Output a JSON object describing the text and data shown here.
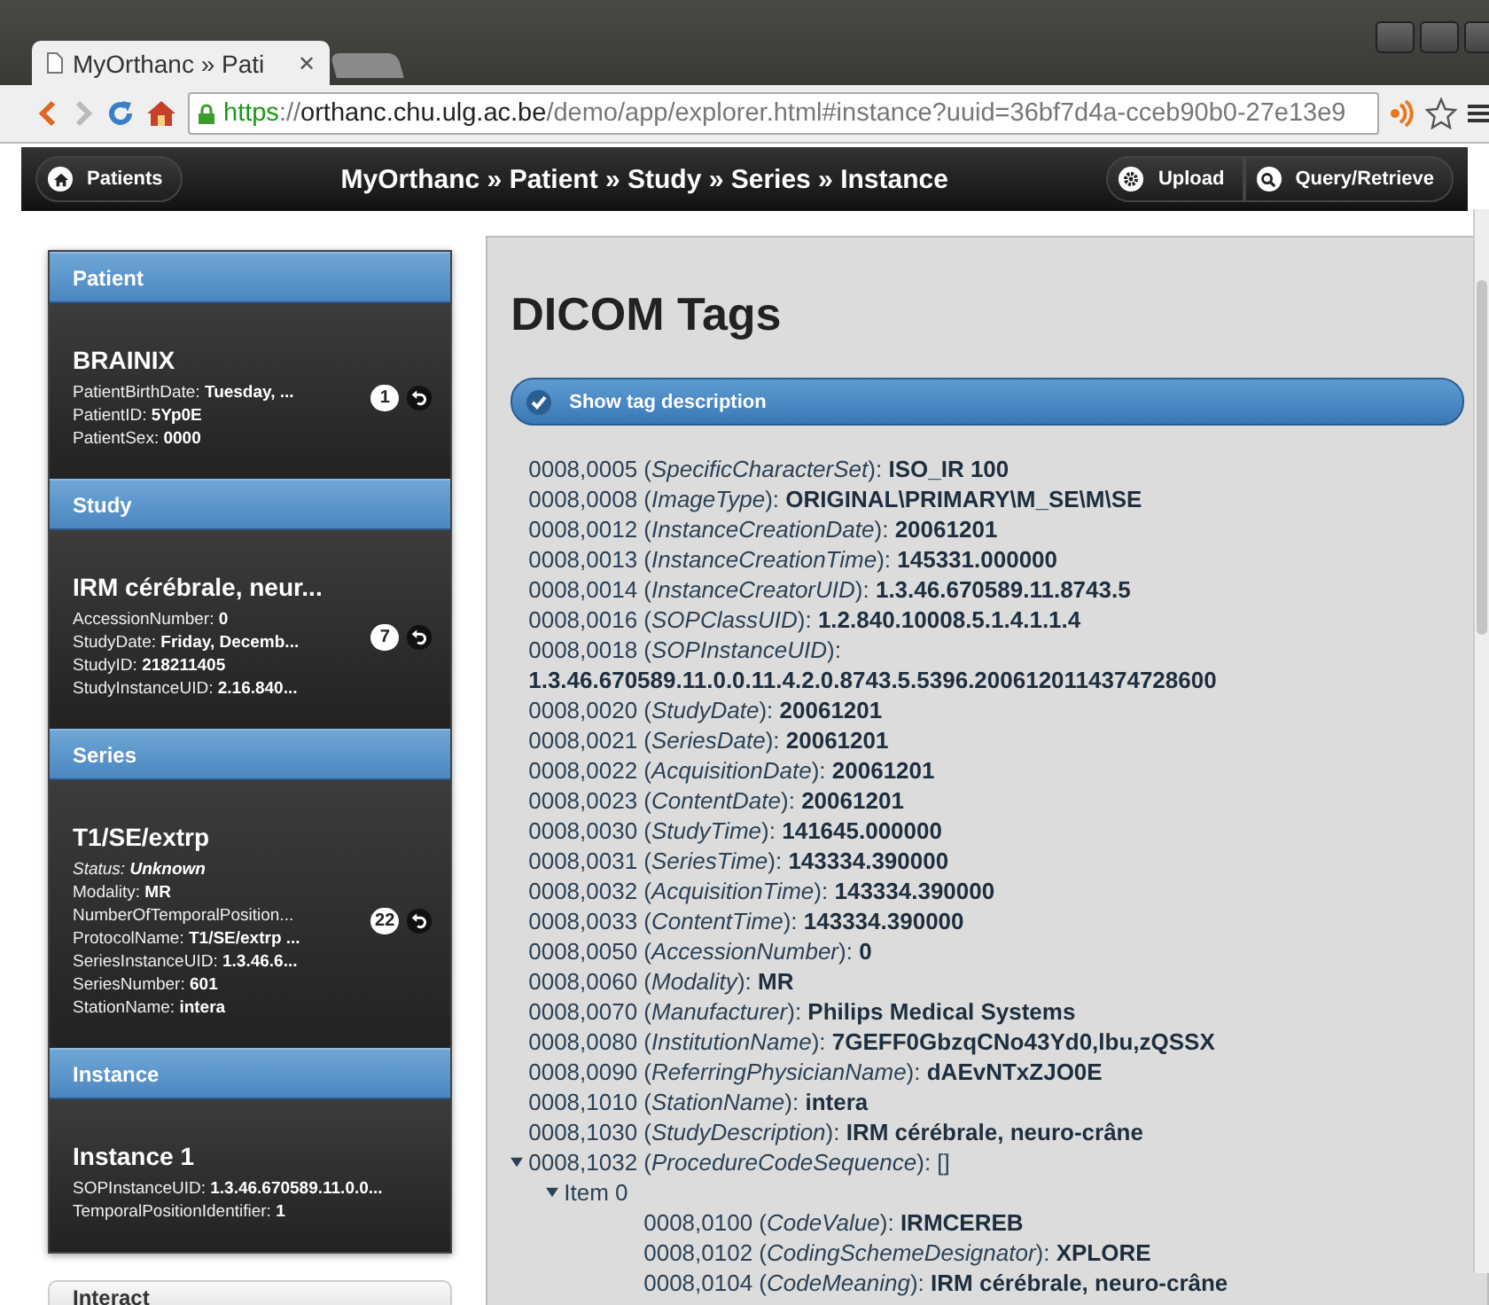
{
  "browser": {
    "tabs": [
      {
        "kind": "page",
        "title": "MyOrthanc » Pati",
        "close": "✕",
        "selected": true
      },
      {
        "kind": "new",
        "selected": false
      }
    ],
    "url": {
      "scheme": "https",
      "separator": "://",
      "host": "orthanc.chu.ulg.ac.be",
      "path": "/demo/app/explorer.html#instance?uuid=36bf7d4a-cceb90b0-27e13e9"
    }
  },
  "navbar": {
    "left_button": "Patients",
    "title": "MyOrthanc » Patient » Study » Series » Instance",
    "right_buttons": [
      "Upload",
      "Query/Retrieve"
    ]
  },
  "sidebar": [
    {
      "header": "Patient",
      "title": "BRAINIX",
      "count": "1",
      "fields": [
        {
          "label": "PatientBirthDate: ",
          "value": "Tuesday, ...",
          "italic": false
        },
        {
          "label": "PatientID: ",
          "value": "5Yp0E",
          "italic": false
        },
        {
          "label": "PatientSex: ",
          "value": "0000",
          "italic": false
        }
      ]
    },
    {
      "header": "Study",
      "title": "IRM cérébrale, neur...",
      "count": "7",
      "fields": [
        {
          "label": "AccessionNumber: ",
          "value": "0",
          "italic": false
        },
        {
          "label": "StudyDate: ",
          "value": "Friday, Decemb...",
          "italic": false
        },
        {
          "label": "StudyID: ",
          "value": "218211405",
          "italic": false
        },
        {
          "label": "StudyInstanceUID: ",
          "value": "2.16.840...",
          "italic": false
        }
      ]
    },
    {
      "header": "Series",
      "title": "T1/SE/extrp",
      "count": "22",
      "fields": [
        {
          "label": "Status: ",
          "value": "Unknown",
          "italic": true
        },
        {
          "label": "Modality: ",
          "value": "MR",
          "italic": false
        },
        {
          "label": "NumberOfTemporalPosition...",
          "italic": false
        },
        {
          "label": "ProtocolName: ",
          "value": "T1/SE/extrp ...",
          "italic": false
        },
        {
          "label": "SeriesInstanceUID: ",
          "value": "1.3.46.6...",
          "italic": false
        },
        {
          "label": "SeriesNumber: ",
          "value": "601",
          "italic": false
        },
        {
          "label": "StationName: ",
          "value": "intera",
          "italic": false
        }
      ]
    },
    {
      "header": "Instance",
      "title": "Instance 1",
      "fields": [
        {
          "label": "SOPInstanceUID: ",
          "value": "1.3.46.670589.11.0.0...",
          "italic": false
        },
        {
          "label": "TemporalPositionIdentifier: ",
          "value": "1",
          "italic": false
        }
      ]
    }
  ],
  "interact": {
    "header": "Interact"
  },
  "content": {
    "title": "DICOM Tags",
    "toggle": {
      "label": "Show tag description",
      "checked": true
    },
    "tags": [
      {
        "line": "0008,0005 (*SpecificCharacterSet*): **ISO_IR 100**"
      },
      {
        "line": "0008,0008 (*ImageType*): **ORIGINAL\\PRIMARY\\M_SE\\M\\SE**"
      },
      {
        "line": "0008,0012 (*InstanceCreationDate*): **20061201**"
      },
      {
        "line": "0008,0013 (*InstanceCreationTime*): **145331.000000**"
      },
      {
        "line": "0008,0014 (*InstanceCreatorUID*): **1.3.46.670589.11.8743.5**"
      },
      {
        "line": "0008,0016 (*SOPClassUID*): **1.2.840.10008.5.1.4.1.1.4**"
      },
      {
        "line": "0008,0018 (*SOPInstanceUID*): **1.3.46.670589.11.0.0.11.4.2.0.8743.5.5396.2006120114374728600**"
      },
      {
        "line": "0008,0020 (*StudyDate*): **20061201**"
      },
      {
        "line": "0008,0021 (*SeriesDate*): **20061201**"
      },
      {
        "line": "0008,0022 (*AcquisitionDate*): **20061201**"
      },
      {
        "line": "0008,0023 (*ContentDate*): **20061201**"
      },
      {
        "line": "0008,0030 (*StudyTime*): **141645.000000**"
      },
      {
        "line": "0008,0031 (*SeriesTime*): **143334.390000**"
      },
      {
        "line": "0008,0032 (*AcquisitionTime*): **143334.390000**"
      },
      {
        "line": "0008,0033 (*ContentTime*): **143334.390000**"
      },
      {
        "line": "0008,0050 (*AccessionNumber*): **0**"
      },
      {
        "line": "0008,0060 (*Modality*): **MR**"
      },
      {
        "line": "0008,0070 (*Manufacturer*): **Philips Medical Systems**"
      },
      {
        "line": "0008,0080 (*InstitutionName*): **7GEFF0GbzqCNo43Yd0,lbu,zQSSX**"
      },
      {
        "line": "0008,0090 (*ReferringPhysicianName*): **dAEvNTxZJO0E**"
      },
      {
        "line": "0008,1010 (*StationName*): **intera**"
      },
      {
        "line": "0008,1030 (*StudyDescription*): **IRM cérébrale, neuro-crâne**"
      },
      {
        "line": "0008,1032 (*ProcedureCodeSequence*): []",
        "expanded": true,
        "children": [
          {
            "line": "Item 0",
            "expanded": true,
            "children": [
              {
                "line": "0008,0100 (*CodeValue*): **IRMCEREB**"
              },
              {
                "line": "0008,0102 (*CodingSchemeDesignator*): **XPLORE**"
              },
              {
                "line": "0008,0104 (*CodeMeaning*): **IRM cérébrale, neuro-crâne**"
              }
            ]
          }
        ]
      }
    ]
  }
}
